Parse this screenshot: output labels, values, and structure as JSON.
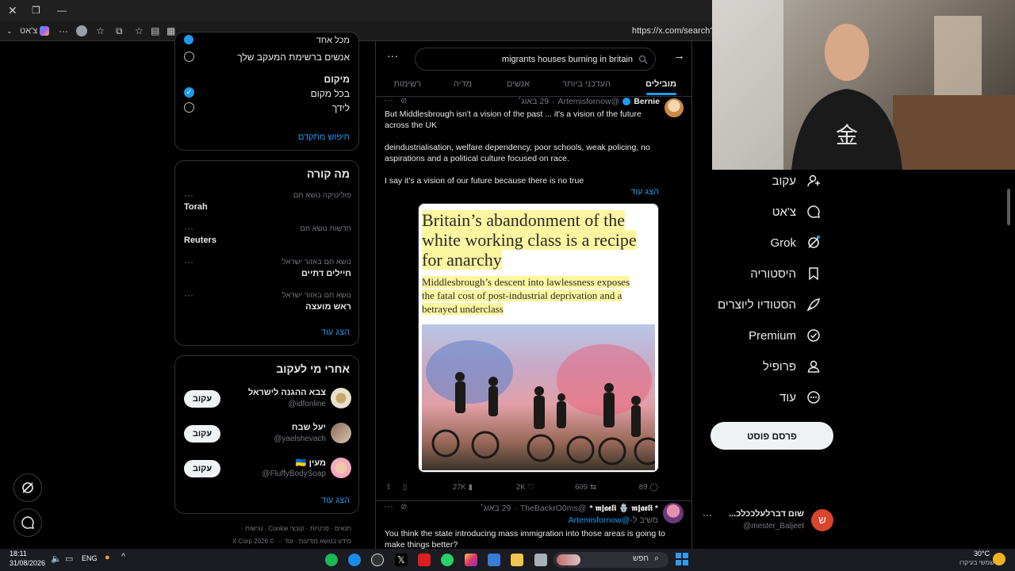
{
  "browser": {
    "url": "https://x.com/search?q=",
    "tab_label": "צ'אט",
    "more": "···"
  },
  "search": {
    "query": "migrants houses burning in britain",
    "more": "···"
  },
  "tabs": [
    "מובילים",
    "העדכני ביותר",
    "אנשים",
    "מדיה",
    "רשימות"
  ],
  "filters": {
    "line_top": "מכל אחד",
    "people_following": "אנשים ברשימת המעקב שלך",
    "location_heading": "מיקום",
    "anywhere": "בכל מקום",
    "near_you": "לידך",
    "advanced": "חיפוש מתקדם"
  },
  "whats_happening": {
    "title": "מה קורה",
    "trends": [
      {
        "context": "פוליטיקה נושא חם",
        "name": "Torah"
      },
      {
        "context": "חדשות נושא חם",
        "name": "Reuters"
      },
      {
        "context": "נושא חם באזור ישראל",
        "name": "חיילים דתיים"
      },
      {
        "context": "נושא חם באזור ישראל",
        "name": "ראש מועצה"
      }
    ],
    "show_more": "הצג עוד"
  },
  "who_to_follow": {
    "title": "אחרי מי לעקוב",
    "accounts": [
      {
        "name": "צבא ההגנה לישראל",
        "handle": "@idfonline",
        "button": "עקוב"
      },
      {
        "name": "יעל שבח",
        "handle": "@yaelshevach",
        "button": "עקוב"
      },
      {
        "name": "מעין 🇺🇦",
        "handle": "@FluffyBodySoap",
        "button": "עקוב"
      }
    ],
    "show_more": "הצג עוד"
  },
  "footer": {
    "line1": "תנאים · פרטיות · קובצי Cookie · נגישות ·",
    "line2": "מידע בנושא מודעות · עוד ··· © X Corp 2026"
  },
  "nav": [
    {
      "label": "עקוב",
      "icon": "add-user-icon"
    },
    {
      "label": "צ'אט",
      "icon": "chat-icon"
    },
    {
      "label": "Grok",
      "icon": "grok-icon"
    },
    {
      "label": "היסטוריה",
      "icon": "bookmark-icon"
    },
    {
      "label": "הסטודיו ליוצרים",
      "icon": "rocket-icon"
    },
    {
      "label": "Premium",
      "icon": "verified-icon"
    },
    {
      "label": "פרופיל",
      "icon": "person-icon"
    },
    {
      "label": "עוד",
      "icon": "more-circle-icon"
    }
  ],
  "post_button": "פרסם פוסט",
  "account": {
    "name": "שום דברלעלככלכ...",
    "handle": "@mester_Baljeet",
    "initial": "ש"
  },
  "tweet1": {
    "author": "Bernie",
    "handle": "@Artemisfornow",
    "date": "29 באוג׳",
    "para1": "But Middlesbrough isn't a vision of the past ... it's a vision of the future across the UK",
    "para2": "deindustrialisation, welfare dependency, poor schools, weak policing, no aspirations and a political culture focused on race.",
    "para3": "I say it's a vision of our future because there is no true",
    "show_more": "הצג עוד",
    "article_headline": "Britain’s abandonment of the white working class is a recipe for anarchy",
    "article_subhead": "Middlesbrough’s descent into lawlessness exposes the fatal cost of post-industrial deprivation and a betrayed underclass",
    "replies": "89",
    "reposts": "609",
    "likes": "2K",
    "views": "27K"
  },
  "tweet2": {
    "author": "* 𝖒𝖏𝖆𝖊𝖑𝖎 🪬 𝖒𝖏𝖆𝖊𝖑𝖎 *",
    "handle": "@TheBackrO0ms",
    "date": "29 באוג׳",
    "reply_prefix": "משיב ל-",
    "reply_to": "@Artemisfornow",
    "text": "You think the state introducing mass immigration into those areas is going to make things better?"
  },
  "taskbar": {
    "time": "18:11",
    "date": "31/08/2026",
    "lang": "ENG",
    "search_label": "חפש",
    "weather_temp": "30°C",
    "weather_desc": "שמשי בעיקרו"
  },
  "colors": {
    "accent": "#1d9bf0",
    "background": "#000000",
    "border": "#2f3336",
    "muted": "#71767b",
    "highlight": "#fdf6a0"
  }
}
